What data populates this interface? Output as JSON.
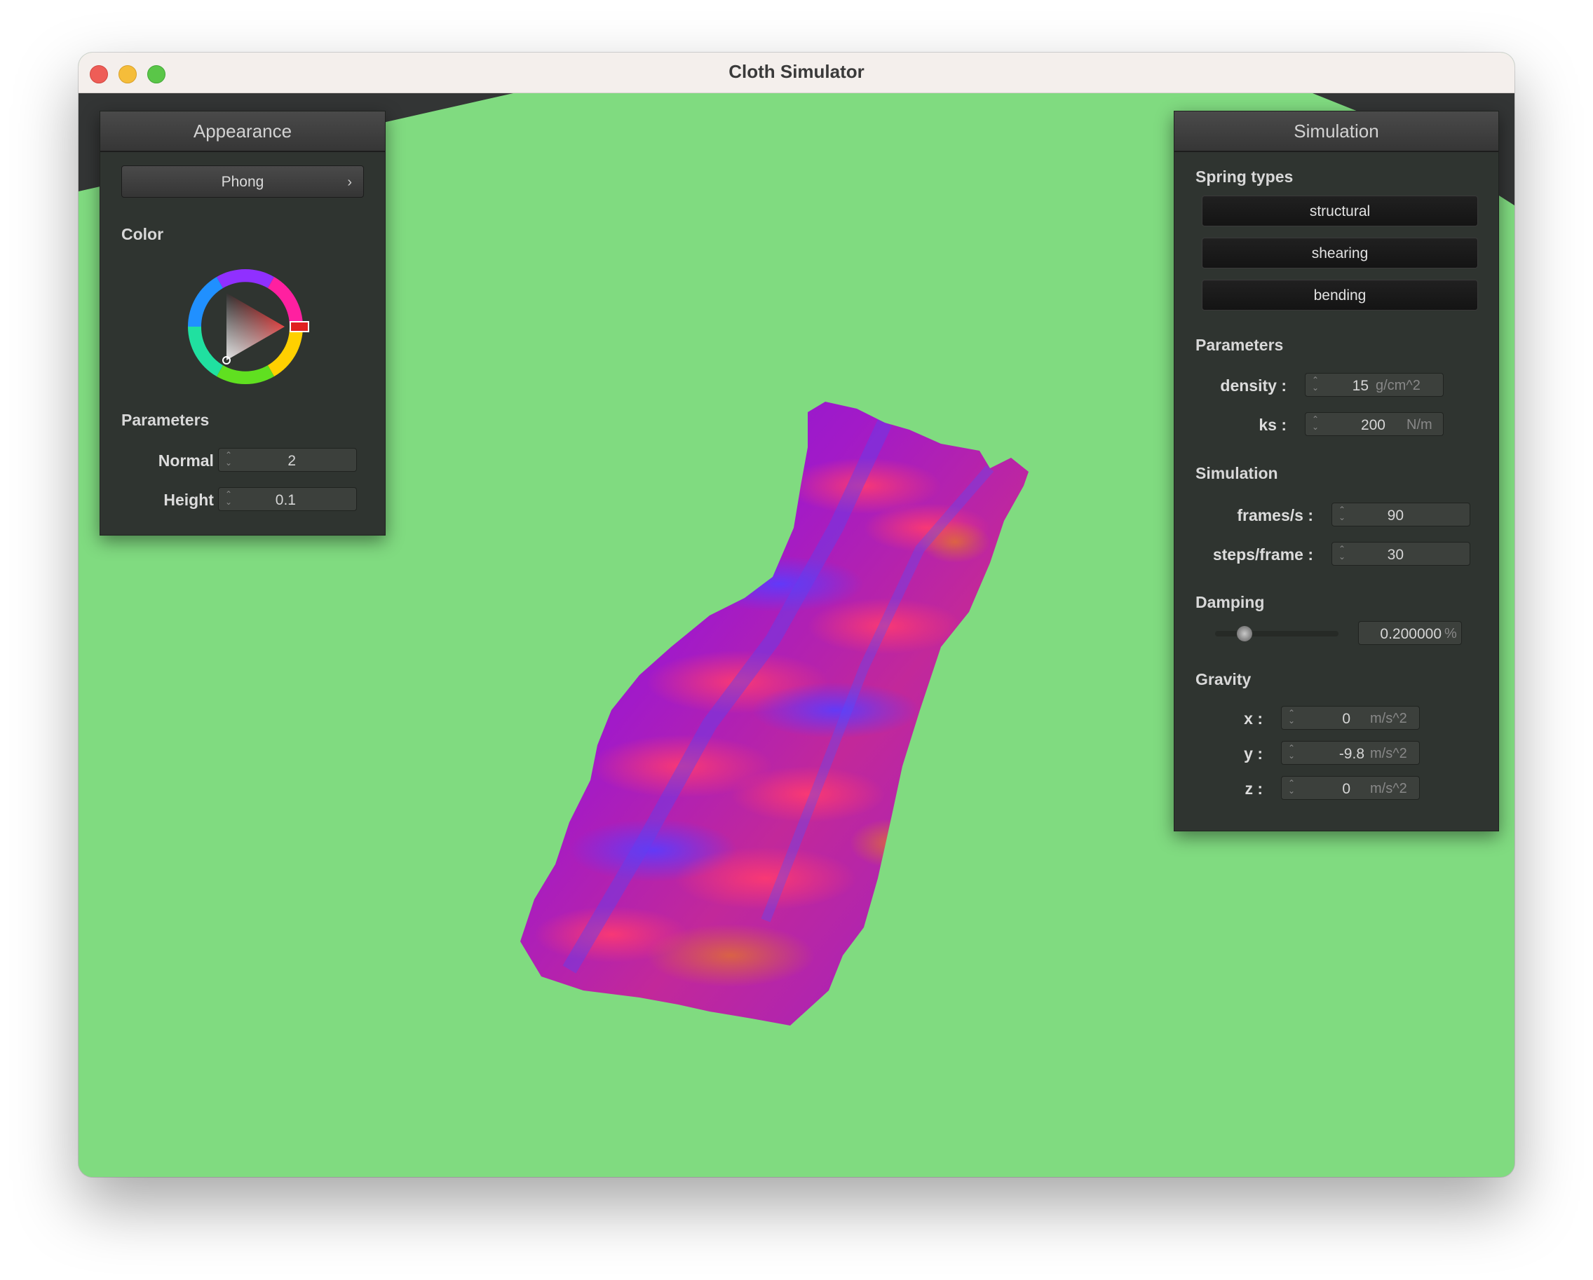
{
  "window": {
    "title": "Cloth Simulator"
  },
  "appearance": {
    "header": "Appearance",
    "shader": "Phong",
    "color_label": "Color",
    "selected_color": "#e02020",
    "params_label": "Parameters",
    "normal": {
      "label": "Normal :",
      "value": "2"
    },
    "height": {
      "label": "Height :",
      "value": "0.1"
    }
  },
  "simulation": {
    "header": "Simulation",
    "spring_types_label": "Spring types",
    "springs": [
      "structural",
      "shearing",
      "bending"
    ],
    "params_label": "Parameters",
    "density": {
      "label": "density :",
      "value": "15",
      "unit": "g/cm^2"
    },
    "ks": {
      "label": "ks :",
      "value": "200",
      "unit": "N/m"
    },
    "sim_label": "Simulation",
    "fps": {
      "label": "frames/s :",
      "value": "90"
    },
    "steps": {
      "label": "steps/frame :",
      "value": "30"
    },
    "damping_label": "Damping",
    "damping": {
      "value": "0.200000",
      "unit": "%",
      "slider_fraction": 0.2
    },
    "gravity_label": "Gravity",
    "gx": {
      "label": "x :",
      "value": "0",
      "unit": "m/s^2"
    },
    "gy": {
      "label": "y :",
      "value": "-9.8",
      "unit": "m/s^2"
    },
    "gz": {
      "label": "z :",
      "value": "0",
      "unit": "m/s^2"
    }
  },
  "colors": {
    "ground": "#80db80",
    "cloth_primary": "#8a1ad0",
    "cloth_secondary": "#e0307a",
    "panel_bg": "#2f3430"
  }
}
